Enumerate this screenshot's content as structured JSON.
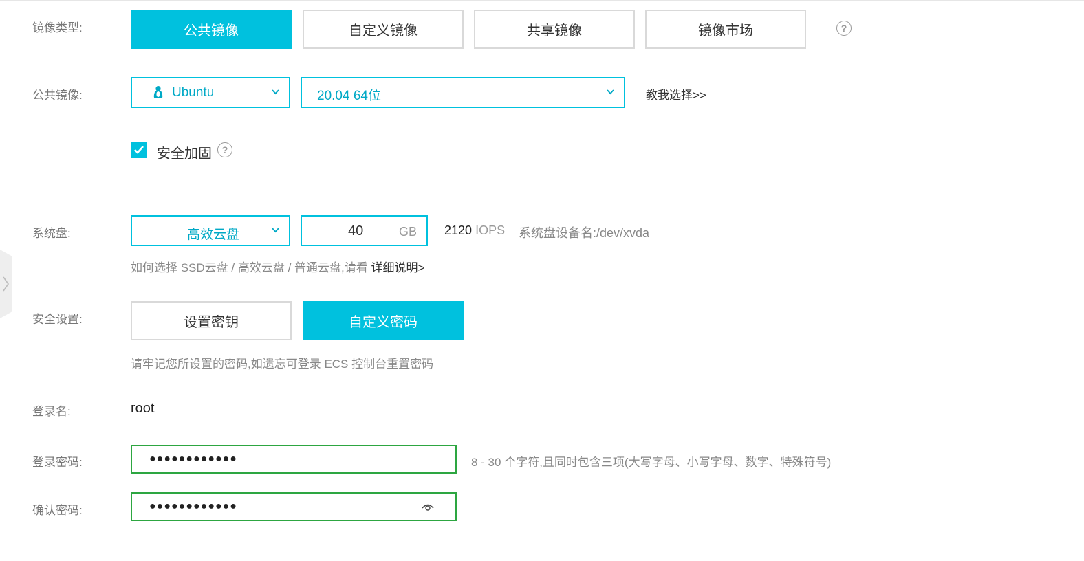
{
  "image_type": {
    "label": "镜像类型:",
    "tabs": [
      {
        "label": "公共镜像",
        "active": true
      },
      {
        "label": "自定义镜像",
        "active": false
      },
      {
        "label": "共享镜像",
        "active": false
      },
      {
        "label": "镜像市场",
        "active": false
      }
    ],
    "help_icon": "question-circle-icon"
  },
  "public_image": {
    "label": "公共镜像:",
    "os_value": "Ubuntu",
    "os_icon": "linux-penguin-icon",
    "version_value": "20.04 64位",
    "help_link": "教我选择>>"
  },
  "security_hardening": {
    "label": "安全加固",
    "checked": true
  },
  "system_disk": {
    "label": "系统盘:",
    "type_value": "高效云盘",
    "size_value": "40",
    "size_unit": "GB",
    "iops_number": "2120",
    "iops_unit": "IOPS",
    "device_info": "系统盘设备名:/dev/xvda",
    "hint_prefix": "如何选择 SSD云盘 / 高效云盘 / 普通云盘,请看",
    "hint_link": "详细说明>"
  },
  "security_settings": {
    "label": "安全设置:",
    "tabs": [
      {
        "label": "设置密钥",
        "active": false
      },
      {
        "label": "自定义密码",
        "active": true
      }
    ],
    "hint": "请牢记您所设置的密码,如遗忘可登录 ECS 控制台重置密码"
  },
  "login_name": {
    "label": "登录名:",
    "value": "root"
  },
  "login_password": {
    "label": "登录密码:",
    "value": "●●●●●●●●●●●●",
    "rule_hint": "8 - 30 个字符,且同时包含三项(大写字母、小写字母、数字、特殊符号)"
  },
  "confirm_password": {
    "label": "确认密码:",
    "value": "●●●●●●●●●●●●",
    "toggle_icon": "eye-icon"
  },
  "colors": {
    "accent": "#00c1de",
    "valid_border": "#2da641"
  }
}
